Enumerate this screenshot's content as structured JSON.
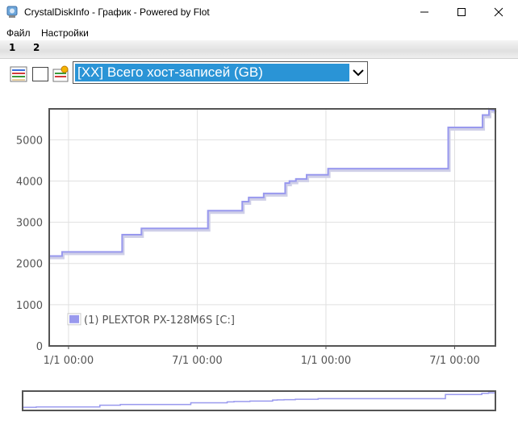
{
  "window": {
    "title": "CrystalDiskInfo - График - Powered by Flot"
  },
  "menu": {
    "file_label": "Файл",
    "settings_label": "Настройки"
  },
  "tabs": [
    {
      "label": "1"
    },
    {
      "label": "2"
    }
  ],
  "toolbar": {
    "select": {
      "value": "[XX] Всего хост-записей (GB)"
    }
  },
  "colors": {
    "series": "#9999ee",
    "select_highlight": "#2a94d6",
    "grid": "#e0e0e0",
    "plot_border": "#545454"
  },
  "chart_data": {
    "type": "line",
    "x_tick_labels": [
      "1/1 00:00",
      "7/1 00:00",
      "1/1 00:00",
      "7/1 00:00"
    ],
    "y_ticks": [
      0,
      1000,
      2000,
      3000,
      4000,
      5000
    ],
    "ylim": [
      0,
      5750
    ],
    "legend": {
      "position": "bottom-left"
    },
    "grid": true,
    "series": [
      {
        "name": "(1) PLEXTOR PX-128M6S [C:]",
        "x_months": [
          0,
          0.6,
          0.6,
          3.4,
          3.4,
          4.3,
          4.3,
          7.4,
          7.4,
          9.0,
          9.0,
          9.3,
          9.3,
          10.0,
          10.0,
          11.0,
          11.0,
          11.2,
          11.2,
          11.5,
          11.5,
          12.0,
          12.0,
          13.0,
          13.0,
          18.6,
          18.6,
          20.2,
          20.2,
          20.5,
          20.5,
          20.8
        ],
        "values": [
          2180,
          2180,
          2280,
          2280,
          2700,
          2700,
          2850,
          2850,
          3280,
          3280,
          3500,
          3500,
          3600,
          3600,
          3700,
          3700,
          3950,
          3950,
          4000,
          4000,
          4050,
          4050,
          4150,
          4150,
          4300,
          4300,
          5300,
          5300,
          5600,
          5600,
          5750,
          5700
        ]
      }
    ]
  }
}
